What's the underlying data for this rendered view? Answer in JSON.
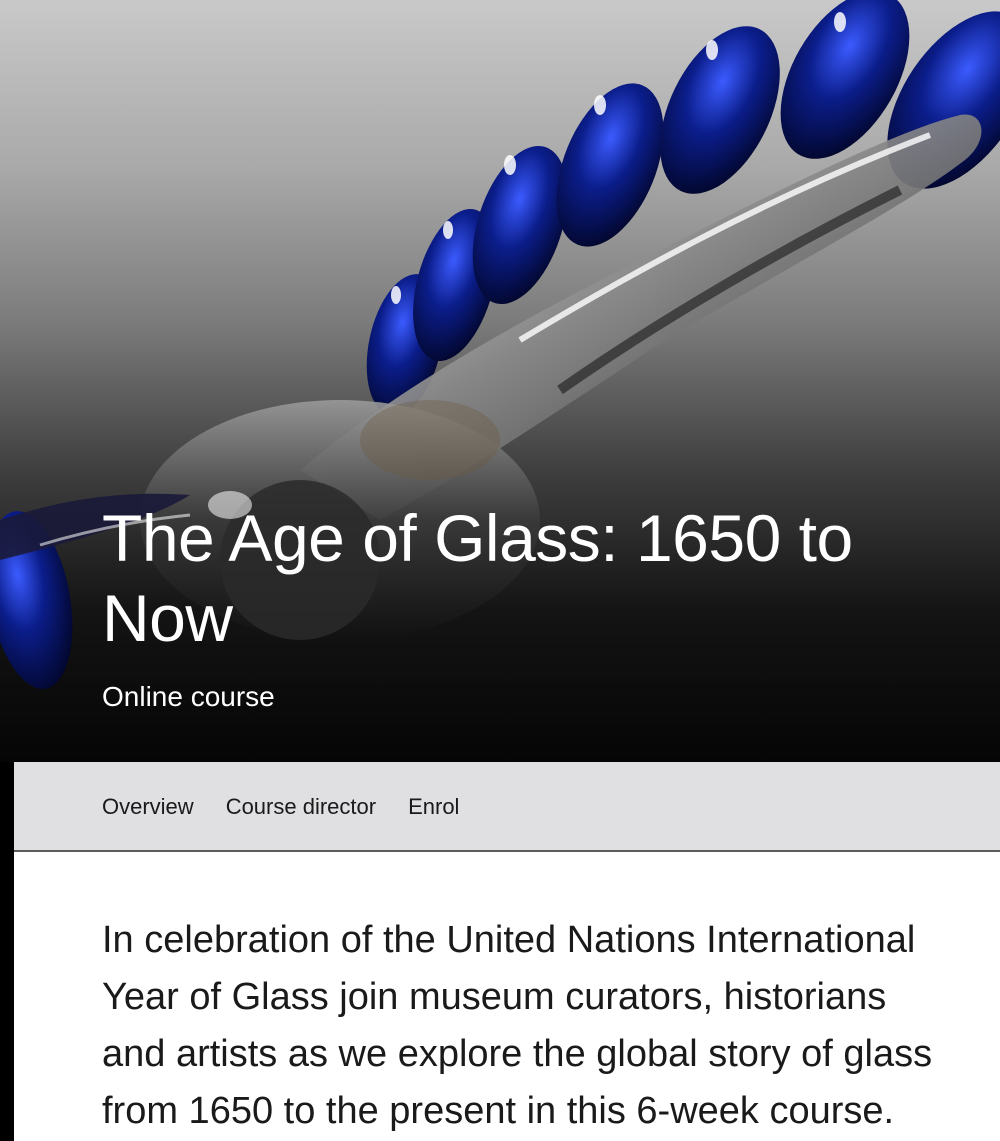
{
  "hero": {
    "title": "The Age of Glass: 1650 to Now",
    "subtitle": "Online course"
  },
  "tabs": [
    {
      "label": "Overview"
    },
    {
      "label": "Course director"
    },
    {
      "label": "Enrol"
    }
  ],
  "intro": {
    "text": "In celebration of the United Nations International\nYear of Glass join museum curators, historians\nand artists as we explore the global story of glass\nfrom 1650 to the present in this 6-week course."
  },
  "colors": {
    "glass_blue": "#0b1d8a",
    "nav_background": "#e0e0e2",
    "text": "#1a1a1a"
  },
  "icons": {
    "hero_image": "blue-glass-object-image"
  }
}
